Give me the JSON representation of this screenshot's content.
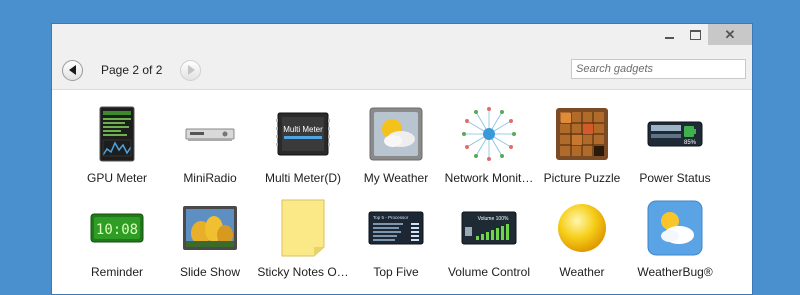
{
  "window": {
    "controls": {
      "minimize": "",
      "maximize": "",
      "close": "✕"
    }
  },
  "toolbar": {
    "page_label": "Page 2 of 2",
    "search_placeholder": "Search gadgets"
  },
  "gadgets": [
    {
      "label": "GPU Meter",
      "icon": "gpu-meter-icon"
    },
    {
      "label": "MiniRadio",
      "icon": "radio-icon"
    },
    {
      "label": "Multi Meter(D)",
      "icon": "multi-meter-icon",
      "icon_text": "Multi Meter"
    },
    {
      "label": "My Weather",
      "icon": "weather-icon"
    },
    {
      "label": "Network Monit…",
      "icon": "network-icon"
    },
    {
      "label": "Picture Puzzle",
      "icon": "puzzle-icon"
    },
    {
      "label": "Power Status",
      "icon": "battery-icon",
      "icon_text": "85%"
    },
    {
      "label": "Reminder",
      "icon": "clock-icon",
      "icon_text": "10:08"
    },
    {
      "label": "Slide Show",
      "icon": "slideshow-icon"
    },
    {
      "label": "Sticky Notes O…",
      "icon": "sticky-note-icon"
    },
    {
      "label": "Top Five",
      "icon": "top-five-icon",
      "icon_text": "Top 5 - Processor"
    },
    {
      "label": "Volume Control",
      "icon": "volume-icon",
      "icon_text": "Volume 100%"
    },
    {
      "label": "Weather",
      "icon": "sun-icon"
    },
    {
      "label": "WeatherBug®",
      "icon": "weatherbug-icon"
    }
  ],
  "colors": {
    "desktop": "#4a90cf",
    "window_frame": "#f0f0f0",
    "close_button": "#c8c8c8"
  }
}
